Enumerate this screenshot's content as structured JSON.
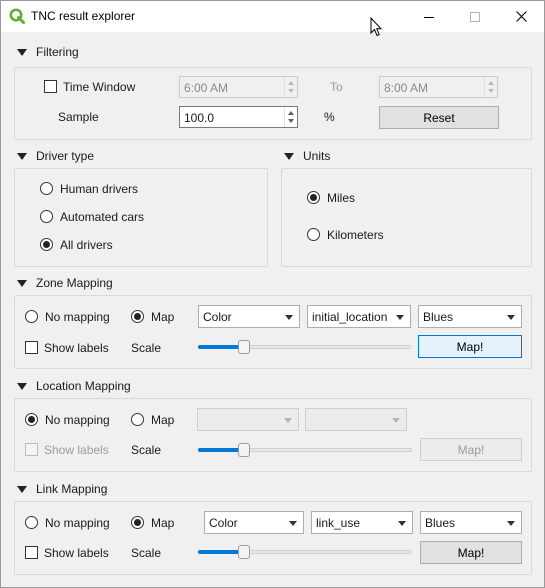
{
  "window": {
    "title": "TNC result explorer"
  },
  "filtering": {
    "header": "Filtering",
    "time_window_label": "Time Window",
    "time_window_checked": false,
    "from_time": "6:00 AM",
    "to_label": "To",
    "to_time": "8:00 AM",
    "sample_label": "Sample",
    "sample_value": "100.0",
    "sample_unit": "%",
    "reset_label": "Reset"
  },
  "driver_type": {
    "header": "Driver type",
    "options": [
      "Human drivers",
      "Automated cars",
      "All drivers"
    ],
    "selected": "All drivers"
  },
  "units": {
    "header": "Units",
    "options": [
      "Miles",
      "Kilometers"
    ],
    "selected": "Miles"
  },
  "zone_mapping": {
    "header": "Zone Mapping",
    "no_mapping_label": "No mapping",
    "map_label": "Map",
    "selected": "Map",
    "combo_type": "Color",
    "combo_field": "initial_location",
    "combo_palette": "Blues",
    "show_labels_label": "Show labels",
    "show_labels_checked": false,
    "scale_label": "Scale",
    "scale_level": 0.2,
    "map_button_label": "Map!"
  },
  "location_mapping": {
    "header": "Location Mapping",
    "no_mapping_label": "No mapping",
    "map_label": "Map",
    "selected": "No mapping",
    "combo_type": "",
    "combo_field": "",
    "show_labels_label": "Show labels",
    "show_labels_checked": false,
    "scale_label": "Scale",
    "scale_level": 0.2,
    "map_button_label": "Map!"
  },
  "link_mapping": {
    "header": "Link Mapping",
    "no_mapping_label": "No mapping",
    "map_label": "Map",
    "selected": "Map",
    "combo_type": "Color",
    "combo_field": "link_use",
    "combo_palette": "Blues",
    "show_labels_label": "Show labels",
    "show_labels_checked": false,
    "scale_label": "Scale",
    "scale_level": 0.2,
    "map_button_label": "Map!"
  },
  "colors": {
    "accent": "#0078d7",
    "app_icon": "#5cb034",
    "panel_border": "#d9d9d9",
    "disabled_text": "#9b9b9b"
  },
  "icons": [
    "qgis-app-icon",
    "minimize-icon",
    "maximize-icon",
    "close-icon",
    "mouse-cursor-icon",
    "collapse-arrow-icon"
  ]
}
